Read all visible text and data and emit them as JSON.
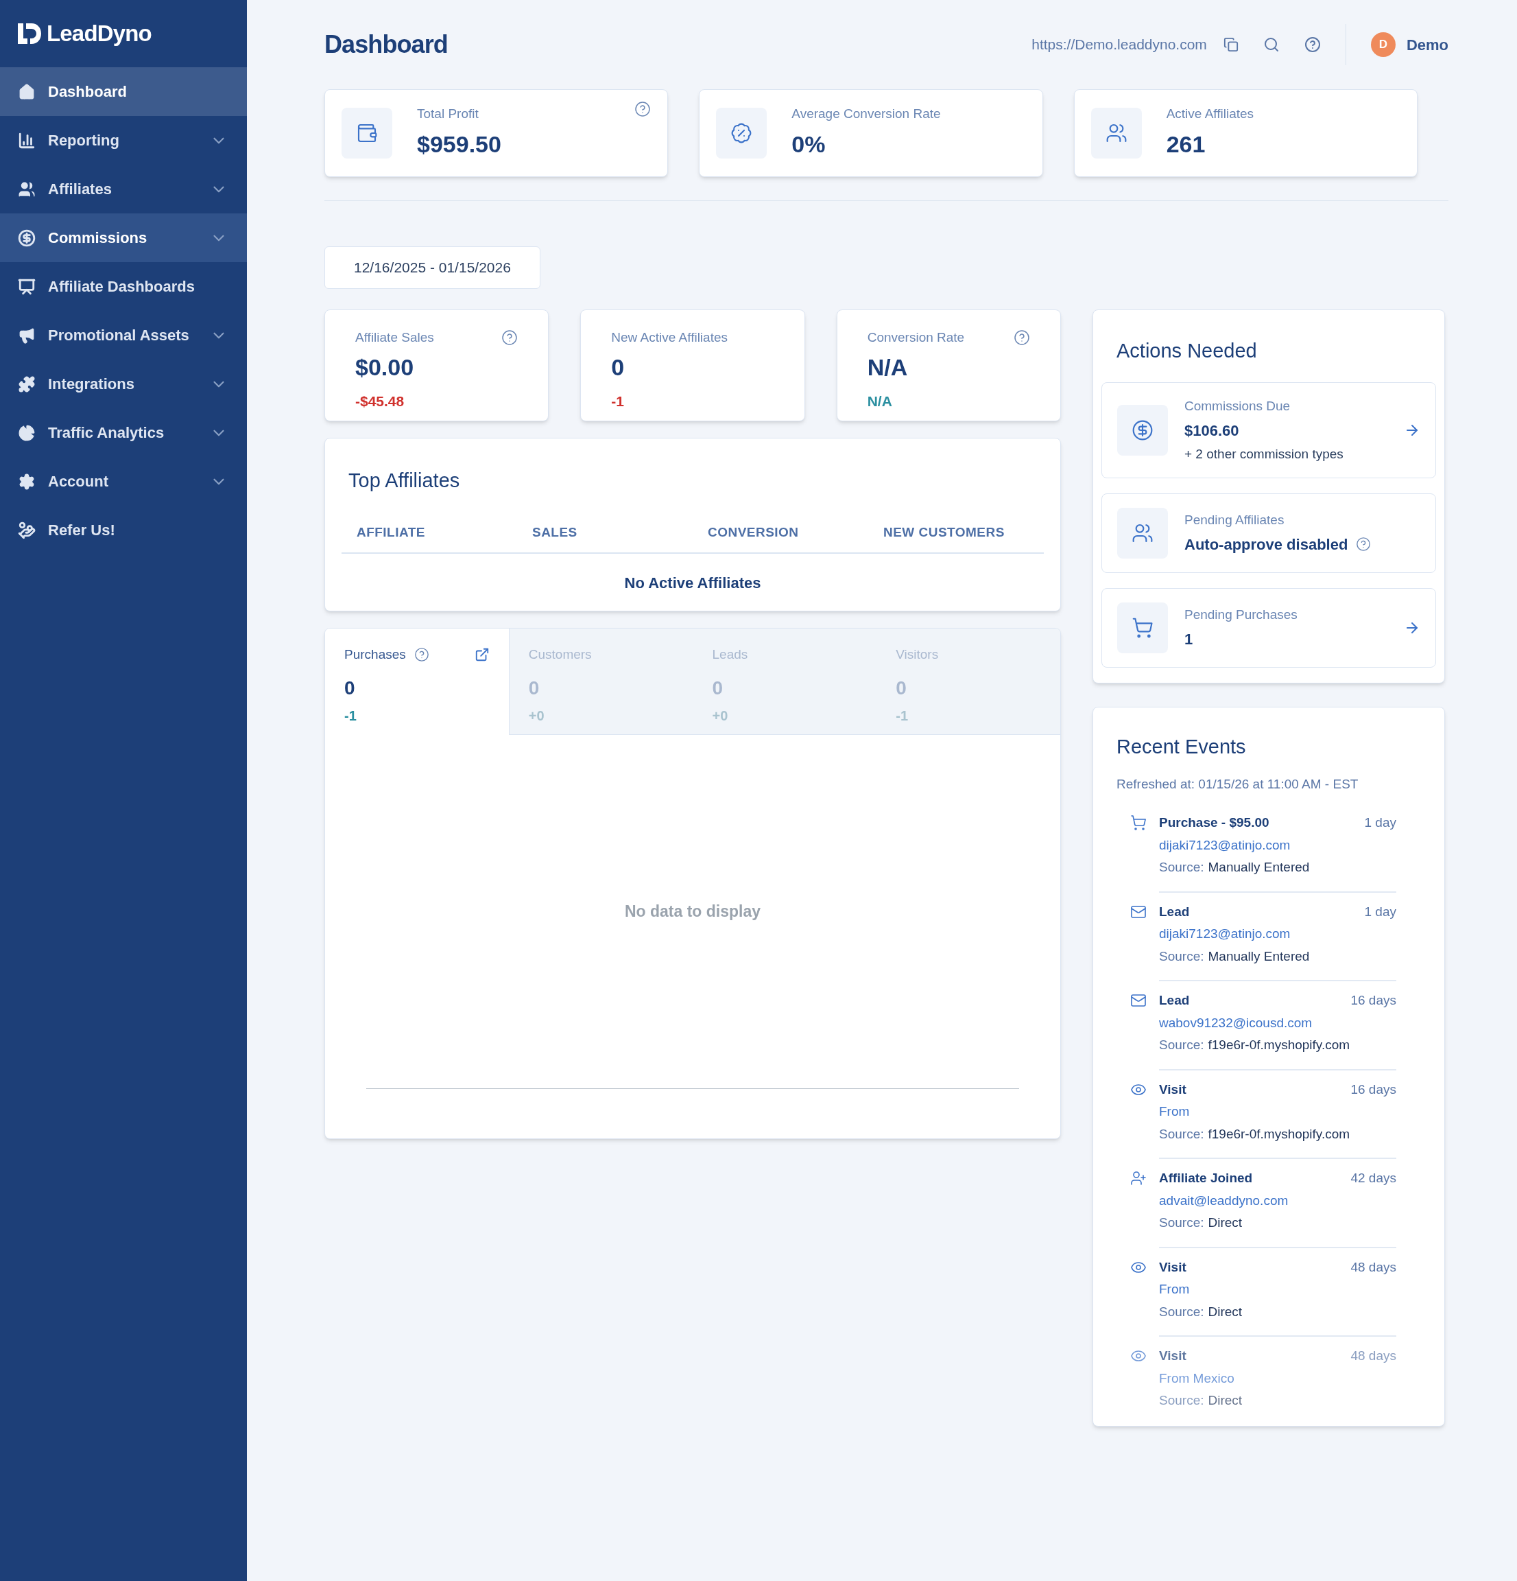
{
  "sidebar": {
    "logo": "LeadDyno",
    "items": [
      {
        "label": "Dashboard",
        "selected": true,
        "hovered": false,
        "expandable": false
      },
      {
        "label": "Reporting",
        "selected": false,
        "hovered": false,
        "expandable": true
      },
      {
        "label": "Affiliates",
        "selected": false,
        "hovered": false,
        "expandable": true
      },
      {
        "label": "Commissions",
        "selected": false,
        "hovered": true,
        "expandable": true
      },
      {
        "label": "Affiliate Dashboards",
        "selected": false,
        "hovered": false,
        "expandable": false
      },
      {
        "label": "Promotional Assets",
        "selected": false,
        "hovered": false,
        "expandable": true
      },
      {
        "label": "Integrations",
        "selected": false,
        "hovered": false,
        "expandable": true
      },
      {
        "label": "Traffic Analytics",
        "selected": false,
        "hovered": false,
        "expandable": true
      },
      {
        "label": "Account",
        "selected": false,
        "hovered": false,
        "expandable": true
      },
      {
        "label": "Refer Us!",
        "selected": false,
        "hovered": false,
        "expandable": false
      }
    ]
  },
  "header": {
    "title": "Dashboard",
    "url": "https://Demo.leaddyno.com",
    "user": {
      "initial": "D",
      "name": "Demo"
    }
  },
  "summary": [
    {
      "label": "Total Profit",
      "value": "$959.50",
      "help": true
    },
    {
      "label": "Average Conversion Rate",
      "value": "0%",
      "help": false
    },
    {
      "label": "Active Affiliates",
      "value": "261",
      "help": false
    }
  ],
  "date_range": "12/16/2025 - 01/15/2026",
  "metrics": [
    {
      "label": "Affiliate Sales",
      "value": "$0.00",
      "delta": "-$45.48",
      "color": "#d0312d",
      "help": true
    },
    {
      "label": "New Active Affiliates",
      "value": "0",
      "delta": "-1",
      "color": "#d0312d",
      "help": false
    },
    {
      "label": "Conversion Rate",
      "value": "N/A",
      "delta": "N/A",
      "color": "#2a8fa0",
      "help": true
    }
  ],
  "top_affiliates": {
    "title": "Top Affiliates",
    "columns": [
      "AFFILIATE",
      "SALES",
      "CONVERSION",
      "NEW CUSTOMERS"
    ],
    "empty": "No Active Affiliates"
  },
  "chart_panel": {
    "tabs": [
      {
        "label": "Purchases",
        "value": "0",
        "delta": "-1",
        "selected": true
      },
      {
        "label": "Customers",
        "value": "0",
        "delta": "+0",
        "selected": false
      },
      {
        "label": "Leads",
        "value": "0",
        "delta": "+0",
        "selected": false
      },
      {
        "label": "Visitors",
        "value": "0",
        "delta": "-1",
        "selected": false
      }
    ],
    "empty": "No data to display"
  },
  "actions": {
    "title": "Actions Needed",
    "items": [
      {
        "kind": "commissions",
        "label": "Commissions Due",
        "value": "$106.60",
        "note": "+ 2 other commission types",
        "arrow": true,
        "help": false
      },
      {
        "kind": "affiliates",
        "label": "Pending Affiliates",
        "value": "Auto-approve disabled",
        "arrow": false,
        "help": true
      },
      {
        "kind": "purchases",
        "label": "Pending Purchases",
        "value": "1",
        "arrow": true,
        "help": false
      }
    ]
  },
  "recent_events": {
    "title": "Recent Events",
    "refreshed": "Refreshed at: 01/15/26 at 11:00 AM - EST",
    "events": [
      {
        "kind": "purchase",
        "title": "Purchase - $95.00",
        "time": "1 day",
        "detail": "dijaki7123@atinjo.com",
        "source_label": "Source:",
        "source": "Manually Entered",
        "faded": false
      },
      {
        "kind": "lead",
        "title": "Lead",
        "time": "1 day",
        "detail": "dijaki7123@atinjo.com",
        "source_label": "Source:",
        "source": "Manually Entered",
        "faded": false
      },
      {
        "kind": "lead",
        "title": "Lead",
        "time": "16 days",
        "detail": "wabov91232@icousd.com",
        "source_label": "Source:",
        "source": "f19e6r-0f.myshopify.com",
        "faded": false
      },
      {
        "kind": "visit",
        "title": "Visit",
        "time": "16 days",
        "detail": "From",
        "source_label": "Source:",
        "source": "f19e6r-0f.myshopify.com",
        "faded": false
      },
      {
        "kind": "joined",
        "title": "Affiliate Joined",
        "time": "42 days",
        "detail": "advait@leaddyno.com",
        "source_label": "Source:",
        "source": "Direct",
        "faded": false
      },
      {
        "kind": "visit",
        "title": "Visit",
        "time": "48 days",
        "detail": "From",
        "source_label": "Source:",
        "source": "Direct",
        "faded": false
      },
      {
        "kind": "visit",
        "title": "Visit",
        "time": "48 days",
        "detail": "From Mexico",
        "source_label": "Source:",
        "source": "Direct",
        "faded": true
      }
    ]
  }
}
